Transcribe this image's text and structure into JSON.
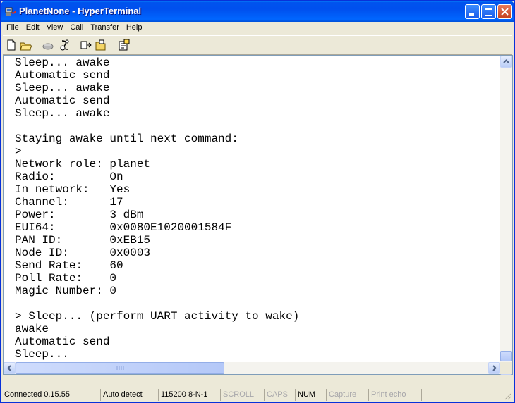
{
  "window": {
    "title": "PlanetNone - HyperTerminal"
  },
  "menu": {
    "items": [
      "File",
      "Edit",
      "View",
      "Call",
      "Transfer",
      "Help"
    ]
  },
  "toolbar": {
    "icons": [
      "new-document-icon",
      "open-folder-icon",
      "connect-phone-icon",
      "disconnect-icon",
      "send-file-icon",
      "receive-file-icon",
      "properties-icon"
    ]
  },
  "terminal": {
    "lines": [
      "Sleep... awake",
      "Automatic send",
      "Sleep... awake",
      "Automatic send",
      "Sleep... awake",
      "",
      "Staying awake until next command:",
      ">",
      "Network role: planet",
      "Radio:        On",
      "In network:   Yes",
      "Channel:      17",
      "Power:        3 dBm",
      "EUI64:        0x0080E1020001584F",
      "PAN ID:       0xEB15",
      "Node ID:      0x0003",
      "Send Rate:    60",
      "Poll Rate:    0",
      "Magic Number: 0",
      "",
      "> Sleep... (perform UART activity to wake)",
      "awake",
      "Automatic send",
      "Sleep..."
    ]
  },
  "status": {
    "connection": "Connected 0.15.55",
    "detect": "Auto detect",
    "settings": "115200 8-N-1",
    "scroll": "SCROLL",
    "caps": "CAPS",
    "num": "NUM",
    "capture": "Capture",
    "print_echo": "Print echo"
  }
}
